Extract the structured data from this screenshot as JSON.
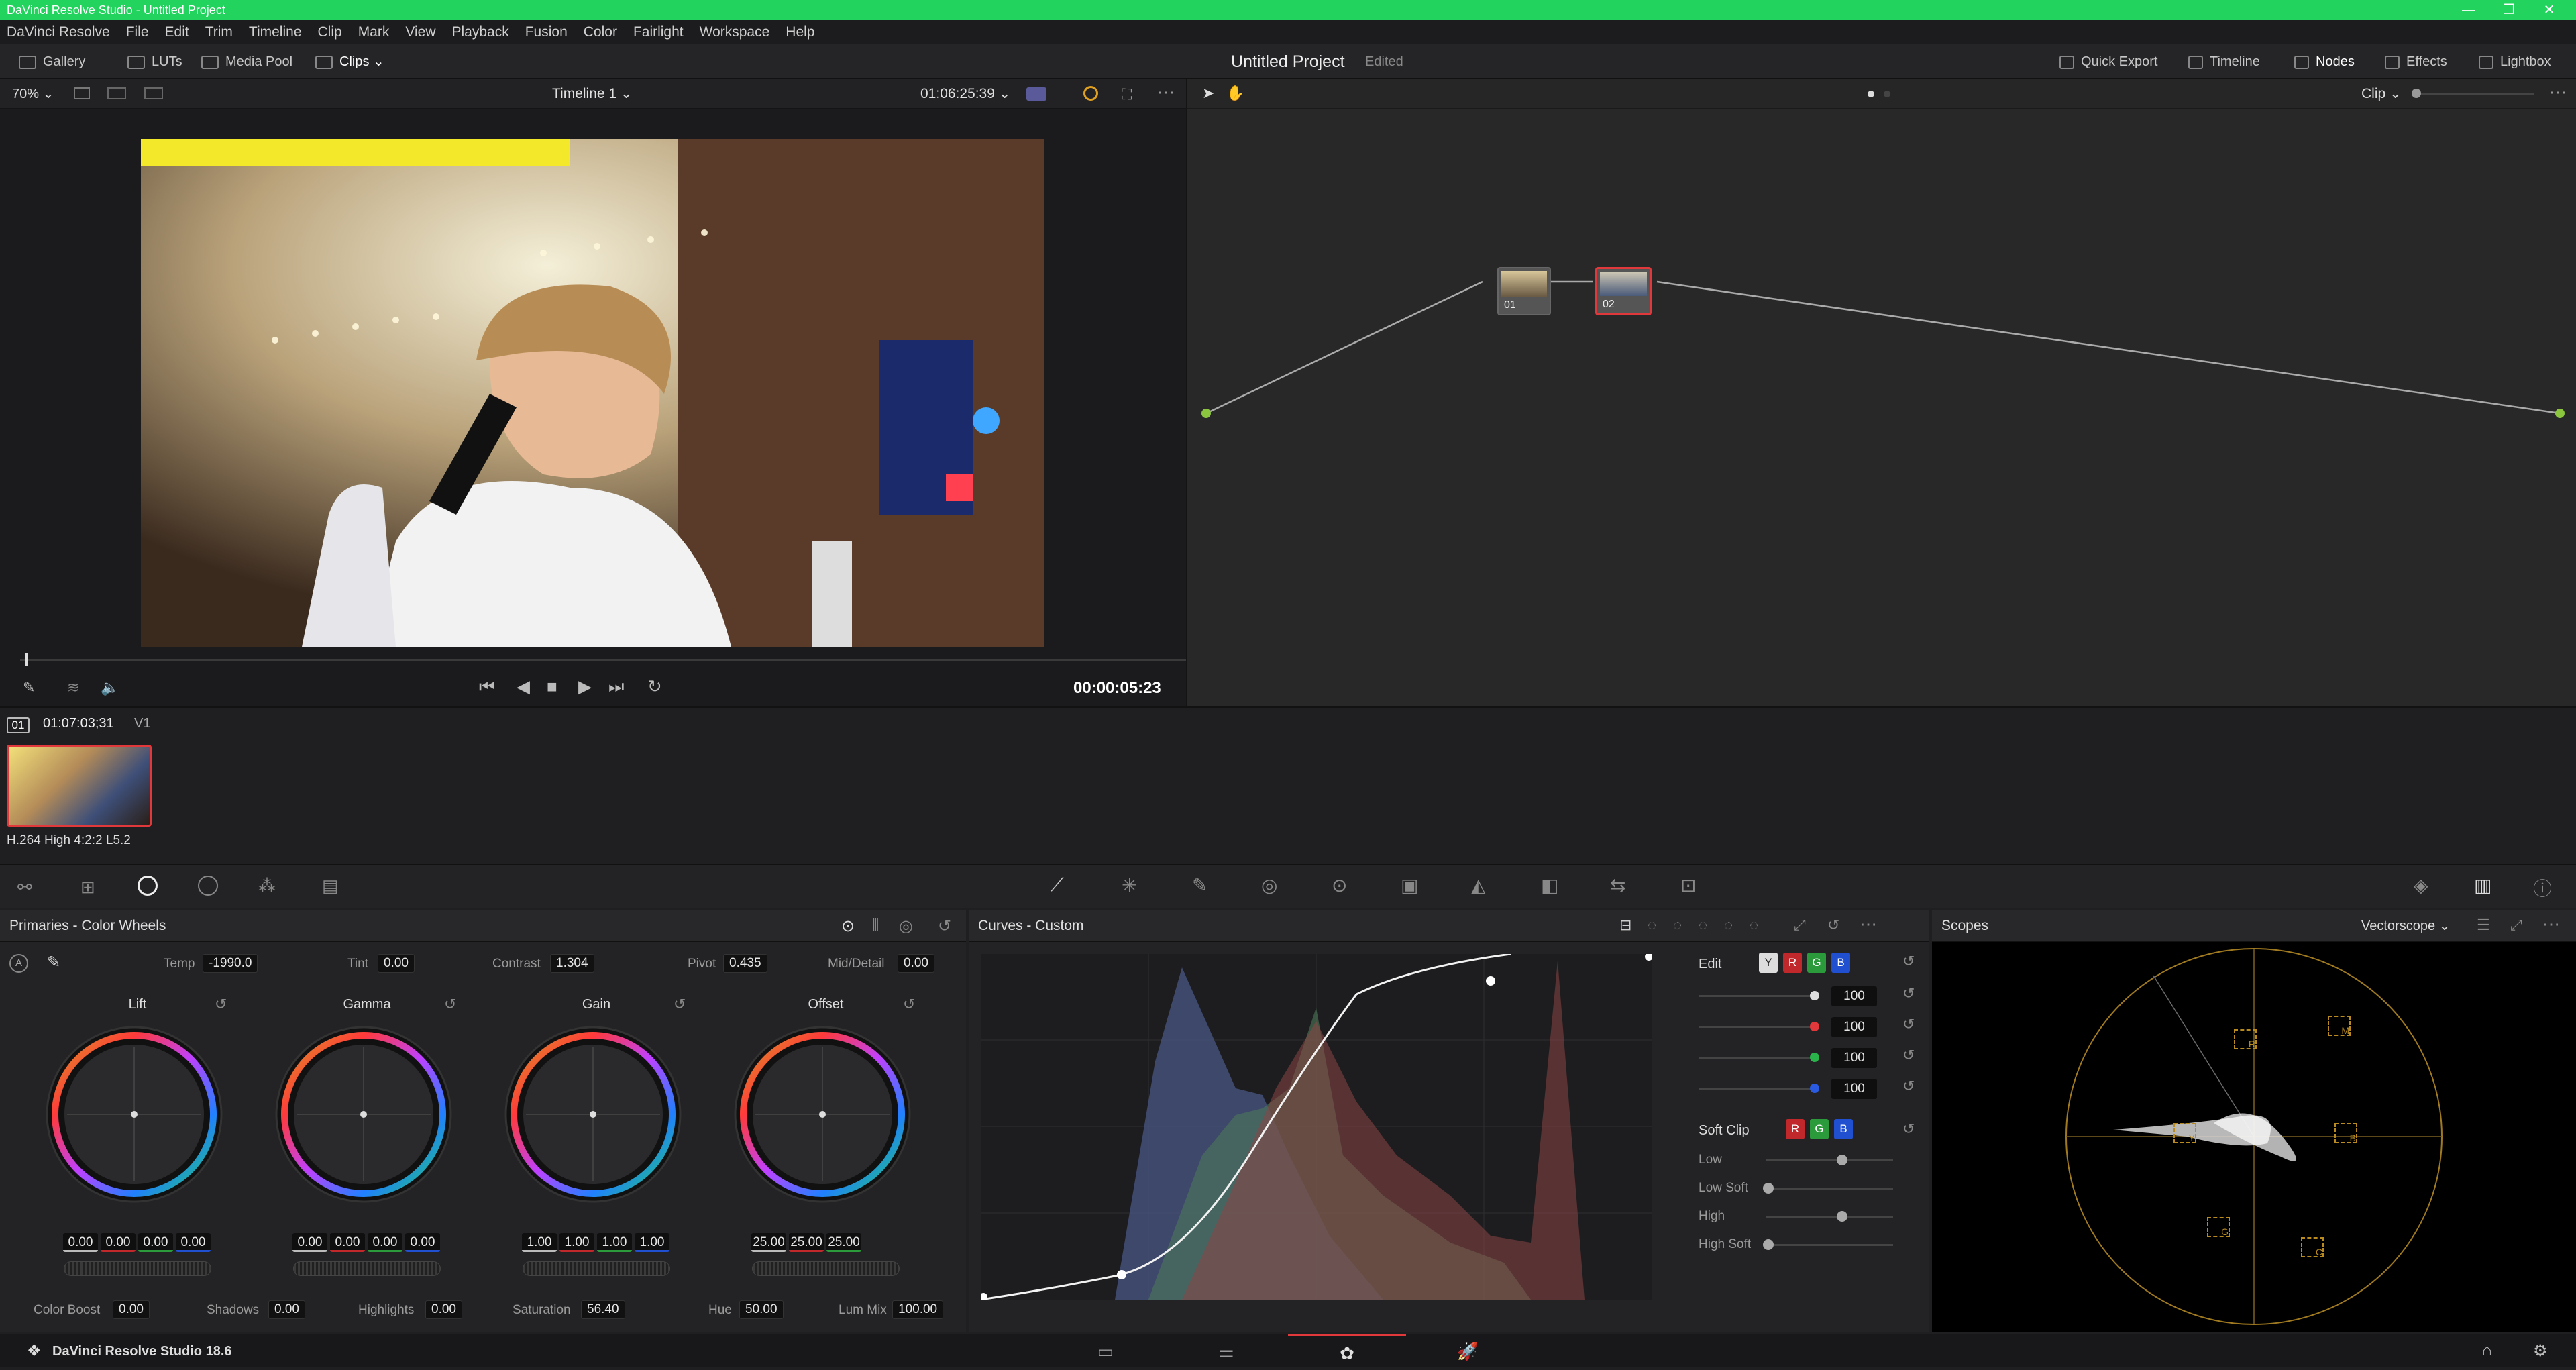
{
  "window": {
    "title": "DaVinci Resolve Studio - Untitled Project",
    "colors": {
      "titlebar": "#22d35e",
      "accent": "#e0383b"
    }
  },
  "menu": [
    "DaVinci Resolve",
    "File",
    "Edit",
    "Trim",
    "Timeline",
    "Clip",
    "Mark",
    "View",
    "Playback",
    "Fusion",
    "Color",
    "Fairlight",
    "Workspace",
    "Help"
  ],
  "toolbar": {
    "gallery": "Gallery",
    "luts": "LUTs",
    "media_pool": "Media Pool",
    "clips": "Clips",
    "project_title": "Untitled Project",
    "project_status": "Edited",
    "quick_export": "Quick Export",
    "timeline": "Timeline",
    "nodes": "Nodes",
    "effects": "Effects",
    "lightbox": "Lightbox"
  },
  "viewer": {
    "zoom": "70%",
    "timeline_name": "Timeline 1",
    "timecode": "01:06:25:39",
    "playhead_tc": "00:00:05:23"
  },
  "nodes": {
    "mode": "Clip",
    "node1": "01",
    "node2": "02"
  },
  "clip": {
    "index": "01",
    "timecode": "01:07:03;31",
    "track": "V1",
    "codec": "H.264 High 4:2:2 L5.2"
  },
  "primaries": {
    "title": "Primaries - Color Wheels",
    "temp_label": "Temp",
    "temp": "-1990.0",
    "tint_label": "Tint",
    "tint": "0.00",
    "contrast_label": "Contrast",
    "contrast": "1.304",
    "pivot_label": "Pivot",
    "pivot": "0.435",
    "middetail_label": "Mid/Detail",
    "middetail": "0.00",
    "wheels": [
      {
        "name": "Lift",
        "values": [
          "0.00",
          "0.00",
          "0.00",
          "0.00"
        ]
      },
      {
        "name": "Gamma",
        "values": [
          "0.00",
          "0.00",
          "0.00",
          "0.00"
        ]
      },
      {
        "name": "Gain",
        "values": [
          "1.00",
          "1.00",
          "1.00",
          "1.00"
        ]
      },
      {
        "name": "Offset",
        "values": [
          "25.00",
          "25.00",
          "25.00"
        ]
      }
    ],
    "bottom": {
      "color_boost_label": "Color Boost",
      "color_boost": "0.00",
      "shadows_label": "Shadows",
      "shadows": "0.00",
      "highlights_label": "Highlights",
      "highlights": "0.00",
      "saturation_label": "Saturation",
      "saturation": "56.40",
      "hue_label": "Hue",
      "hue": "50.00",
      "lummix_label": "Lum Mix",
      "lummix": "100.00"
    }
  },
  "curves": {
    "title": "Curves - Custom",
    "edit_label": "Edit",
    "channels": [
      "Y",
      "R",
      "G",
      "B"
    ],
    "intensity": [
      "100",
      "100",
      "100",
      "100"
    ],
    "soft_clip_label": "Soft Clip",
    "low_label": "Low",
    "low_soft_label": "Low Soft",
    "high_label": "High",
    "high_soft_label": "High Soft"
  },
  "scopes": {
    "title": "Scopes",
    "type": "Vectorscope",
    "targets": [
      "R",
      "M",
      "B",
      "C",
      "G",
      "Y"
    ]
  },
  "status": {
    "app_version": "DaVinci Resolve Studio 18.6"
  }
}
